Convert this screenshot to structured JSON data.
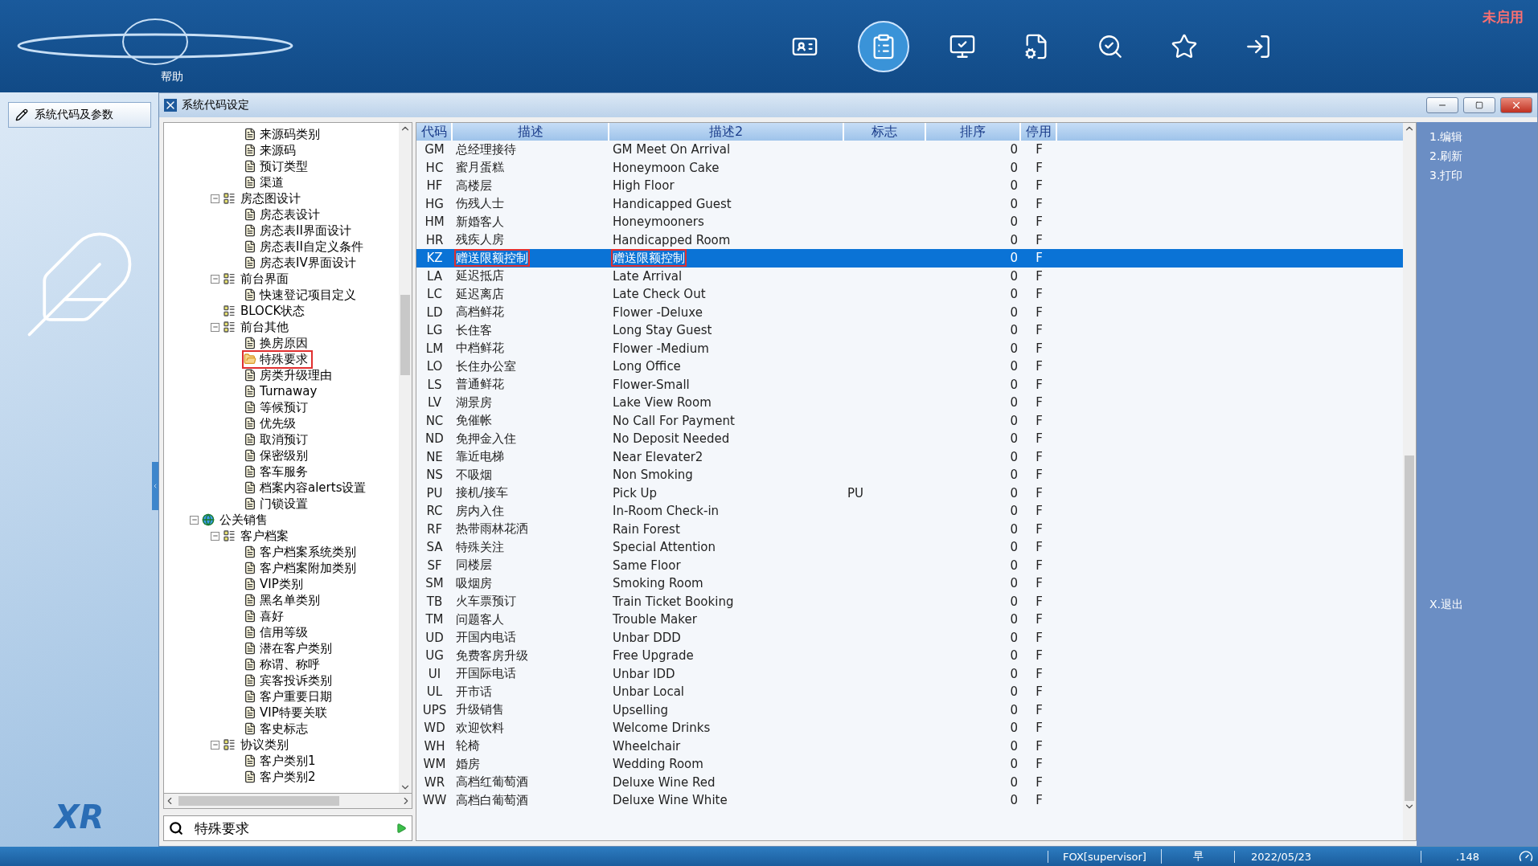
{
  "top_bar": {
    "help": "帮助",
    "status_badge": "未启用",
    "toolbar": [
      {
        "kind": "card",
        "selected": false
      },
      {
        "kind": "clipboard",
        "selected": true
      },
      {
        "kind": "screen",
        "selected": false
      },
      {
        "kind": "document",
        "selected": false
      },
      {
        "kind": "search",
        "selected": false
      },
      {
        "kind": "star",
        "selected": false
      },
      {
        "kind": "exit",
        "selected": false
      }
    ]
  },
  "side": {
    "nav_button": "系统代码及参数",
    "logo": "XR"
  },
  "window": {
    "title": "系统代码设定"
  },
  "tree": {
    "items": [
      {
        "kind": "group",
        "children": [
          {
            "kind": "group",
            "children": [
              {
                "kind": "leaf",
                "label": "来源码类别",
                "selected": false
              },
              {
                "kind": "leaf",
                "label": "来源码",
                "selected": false
              },
              {
                "kind": "leaf",
                "label": "预订类型",
                "selected": false
              },
              {
                "kind": "leaf",
                "label": "渠道",
                "selected": false
              }
            ]
          },
          {
            "kind": "folder",
            "label": "房态图设计",
            "expanded": true,
            "children": [
              {
                "kind": "leaf",
                "label": "房态表设计",
                "selected": false
              },
              {
                "kind": "leaf",
                "label": "房态表II界面设计",
                "selected": false
              },
              {
                "kind": "leaf",
                "label": "房态表II自定义条件",
                "selected": false
              },
              {
                "kind": "leaf",
                "label": "房态表IV界面设计",
                "selected": false
              }
            ]
          },
          {
            "kind": "folder",
            "label": "前台界面",
            "expanded": true,
            "children": [
              {
                "kind": "leaf",
                "label": "快速登记项目定义",
                "selected": false
              }
            ]
          },
          {
            "kind": "folder",
            "label": "BLOCK状态"
          },
          {
            "kind": "folder",
            "label": "前台其他",
            "expanded": true,
            "children": [
              {
                "kind": "leaf",
                "label": "换房原因",
                "selected": false
              },
              {
                "kind": "leaf",
                "label": "特殊要求",
                "selected": true
              },
              {
                "kind": "leaf",
                "label": "房类升级理由",
                "selected": false
              },
              {
                "kind": "leaf",
                "label": "Turnaway",
                "selected": false
              },
              {
                "kind": "leaf",
                "label": "等候预订",
                "selected": false
              },
              {
                "kind": "leaf",
                "label": "优先级",
                "selected": false
              },
              {
                "kind": "leaf",
                "label": "取消预订",
                "selected": false
              },
              {
                "kind": "leaf",
                "label": "保密级别",
                "selected": false
              },
              {
                "kind": "leaf",
                "label": "客车服务",
                "selected": false
              },
              {
                "kind": "leaf",
                "label": "档案内容alerts设置",
                "selected": false
              },
              {
                "kind": "leaf",
                "label": "门锁设置",
                "selected": false
              }
            ]
          }
        ]
      },
      {
        "kind": "globe",
        "label": "公关销售",
        "expanded": true,
        "children": [
          {
            "kind": "folder",
            "label": "客户档案",
            "expanded": true,
            "children": [
              {
                "kind": "leaf",
                "label": "客户档案系统类别",
                "selected": false
              },
              {
                "kind": "leaf",
                "label": "客户档案附加类别",
                "selected": false
              },
              {
                "kind": "leaf",
                "label": "VIP类别",
                "selected": false
              },
              {
                "kind": "leaf",
                "label": "黑名单类别",
                "selected": false
              },
              {
                "kind": "leaf",
                "label": "喜好",
                "selected": false
              },
              {
                "kind": "leaf",
                "label": "信用等级",
                "selected": false
              },
              {
                "kind": "leaf",
                "label": "潜在客户类别",
                "selected": false
              },
              {
                "kind": "leaf",
                "label": "称谓、称呼",
                "selected": false
              },
              {
                "kind": "leaf",
                "label": "宾客投诉类别",
                "selected": false
              },
              {
                "kind": "leaf",
                "label": "客户重要日期",
                "selected": false
              },
              {
                "kind": "leaf",
                "label": "VIP特要关联",
                "selected": false
              },
              {
                "kind": "leaf",
                "label": "客史标志",
                "selected": false
              }
            ]
          },
          {
            "kind": "folder",
            "label": "协议类别",
            "expanded": true,
            "children": [
              {
                "kind": "leaf",
                "label": "客户类别1",
                "selected": false
              },
              {
                "kind": "leaf",
                "label": "客户类别2",
                "selected": false
              }
            ]
          }
        ]
      }
    ]
  },
  "search": {
    "value": "特殊要求"
  },
  "table": {
    "columns": [
      "代码",
      "描述",
      "描述2",
      "标志",
      "排序",
      "停用"
    ],
    "rows": [
      {
        "code": "GM",
        "desc": "总经理接待",
        "desc2": "GM Meet On Arrival",
        "order": "0",
        "disabled": "F",
        "selected": false
      },
      {
        "code": "HC",
        "desc": "蜜月蛋糕",
        "desc2": "Honeymoon Cake",
        "order": "0",
        "disabled": "F",
        "selected": false
      },
      {
        "code": "HF",
        "desc": "高楼层",
        "desc2": "High Floor",
        "order": "0",
        "disabled": "F",
        "selected": false
      },
      {
        "code": "HG",
        "desc": "伤残人士",
        "desc2": "Handicapped Guest",
        "order": "0",
        "disabled": "F",
        "selected": false
      },
      {
        "code": "HM",
        "desc": "新婚客人",
        "desc2": "Honeymooners",
        "order": "0",
        "disabled": "F",
        "selected": false
      },
      {
        "code": "HR",
        "desc": "残疾人房",
        "desc2": "Handicapped Room",
        "order": "0",
        "disabled": "F",
        "selected": false
      },
      {
        "code": "KZ",
        "desc": "赠送限额控制",
        "desc2": "赠送限额控制",
        "order": "0",
        "disabled": "F",
        "selected": true
      },
      {
        "code": "LA",
        "desc": "延迟抵店",
        "desc2": "Late Arrival",
        "order": "0",
        "disabled": "F",
        "selected": false
      },
      {
        "code": "LC",
        "desc": "延迟离店",
        "desc2": "Late Check Out",
        "order": "0",
        "disabled": "F",
        "selected": false
      },
      {
        "code": "LD",
        "desc": "高档鲜花",
        "desc2": "Flower -Deluxe",
        "order": "0",
        "disabled": "F",
        "selected": false
      },
      {
        "code": "LG",
        "desc": "长住客",
        "desc2": "Long Stay Guest",
        "order": "0",
        "disabled": "F",
        "selected": false
      },
      {
        "code": "LM",
        "desc": "中档鲜花",
        "desc2": "Flower -Medium",
        "order": "0",
        "disabled": "F",
        "selected": false
      },
      {
        "code": "LO",
        "desc": "长住办公室",
        "desc2": "Long Office",
        "order": "0",
        "disabled": "F",
        "selected": false
      },
      {
        "code": "LS",
        "desc": "普通鲜花",
        "desc2": "Flower-Small",
        "order": "0",
        "disabled": "F",
        "selected": false
      },
      {
        "code": "LV",
        "desc": "湖景房",
        "desc2": "Lake View Room",
        "order": "0",
        "disabled": "F",
        "selected": false
      },
      {
        "code": "NC",
        "desc": "免催帐",
        "desc2": "No Call For Payment",
        "order": "0",
        "disabled": "F",
        "selected": false
      },
      {
        "code": "ND",
        "desc": "免押金入住",
        "desc2": "No Deposit Needed",
        "order": "0",
        "disabled": "F",
        "selected": false
      },
      {
        "code": "NE",
        "desc": "靠近电梯",
        "desc2": "Near Elevater2",
        "order": "0",
        "disabled": "F",
        "selected": false
      },
      {
        "code": "NS",
        "desc": "不吸烟",
        "desc2": "Non Smoking",
        "order": "0",
        "disabled": "F",
        "selected": false
      },
      {
        "code": "PU",
        "desc": "接机/接车",
        "desc2": "Pick Up",
        "flag": "PU",
        "order": "0",
        "disabled": "F",
        "selected": false
      },
      {
        "code": "RC",
        "desc": "房内入住",
        "desc2": "In-Room Check-in",
        "order": "0",
        "disabled": "F",
        "selected": false
      },
      {
        "code": "RF",
        "desc": "热带雨林花洒",
        "desc2": "Rain Forest",
        "order": "0",
        "disabled": "F",
        "selected": false
      },
      {
        "code": "SA",
        "desc": "特殊关注",
        "desc2": "Special Attention",
        "order": "0",
        "disabled": "F",
        "selected": false
      },
      {
        "code": "SF",
        "desc": "同楼层",
        "desc2": "Same Floor",
        "order": "0",
        "disabled": "F",
        "selected": false
      },
      {
        "code": "SM",
        "desc": "吸烟房",
        "desc2": "Smoking Room",
        "order": "0",
        "disabled": "F",
        "selected": false
      },
      {
        "code": "TB",
        "desc": "火车票预订",
        "desc2": "Train Ticket Booking",
        "order": "0",
        "disabled": "F",
        "selected": false
      },
      {
        "code": "TM",
        "desc": "问题客人",
        "desc2": "Trouble Maker",
        "order": "0",
        "disabled": "F",
        "selected": false
      },
      {
        "code": "UD",
        "desc": "开国内电话",
        "desc2": "Unbar DDD",
        "order": "0",
        "disabled": "F",
        "selected": false
      },
      {
        "code": "UG",
        "desc": "免费客房升级",
        "desc2": "Free Upgrade",
        "order": "0",
        "disabled": "F",
        "selected": false
      },
      {
        "code": "UI",
        "desc": "开国际电话",
        "desc2": "Unbar IDD",
        "order": "0",
        "disabled": "F",
        "selected": false
      },
      {
        "code": "UL",
        "desc": "开市话",
        "desc2": "Unbar Local",
        "order": "0",
        "disabled": "F",
        "selected": false
      },
      {
        "code": "UPS",
        "desc": "升级销售",
        "desc2": "Upselling",
        "order": "0",
        "disabled": "F",
        "selected": false
      },
      {
        "code": "WD",
        "desc": "欢迎饮料",
        "desc2": "Welcome Drinks",
        "order": "0",
        "disabled": "F",
        "selected": false
      },
      {
        "code": "WH",
        "desc": "轮椅",
        "desc2": "Wheelchair",
        "order": "0",
        "disabled": "F",
        "selected": false
      },
      {
        "code": "WM",
        "desc": "婚房",
        "desc2": "Wedding Room",
        "order": "0",
        "disabled": "F",
        "selected": false
      },
      {
        "code": "WR",
        "desc": "高档红葡萄酒",
        "desc2": "Deluxe Wine Red",
        "order": "0",
        "disabled": "F",
        "selected": false
      },
      {
        "code": "WW",
        "desc": "高档白葡萄酒",
        "desc2": "Deluxe Wine White",
        "order": "0",
        "disabled": "F",
        "selected": false
      }
    ]
  },
  "right_menu": [
    {
      "kind": "action",
      "label": "1.编辑"
    },
    {
      "kind": "action",
      "label": "2.刷新"
    },
    {
      "kind": "action",
      "label": "3.打印"
    },
    {
      "kind": "exit",
      "label": "X.退出"
    }
  ],
  "status_bar": {
    "user": "FOX[supervisor]",
    "shift": "早",
    "date": "2022/05/23",
    "code": ".148"
  }
}
